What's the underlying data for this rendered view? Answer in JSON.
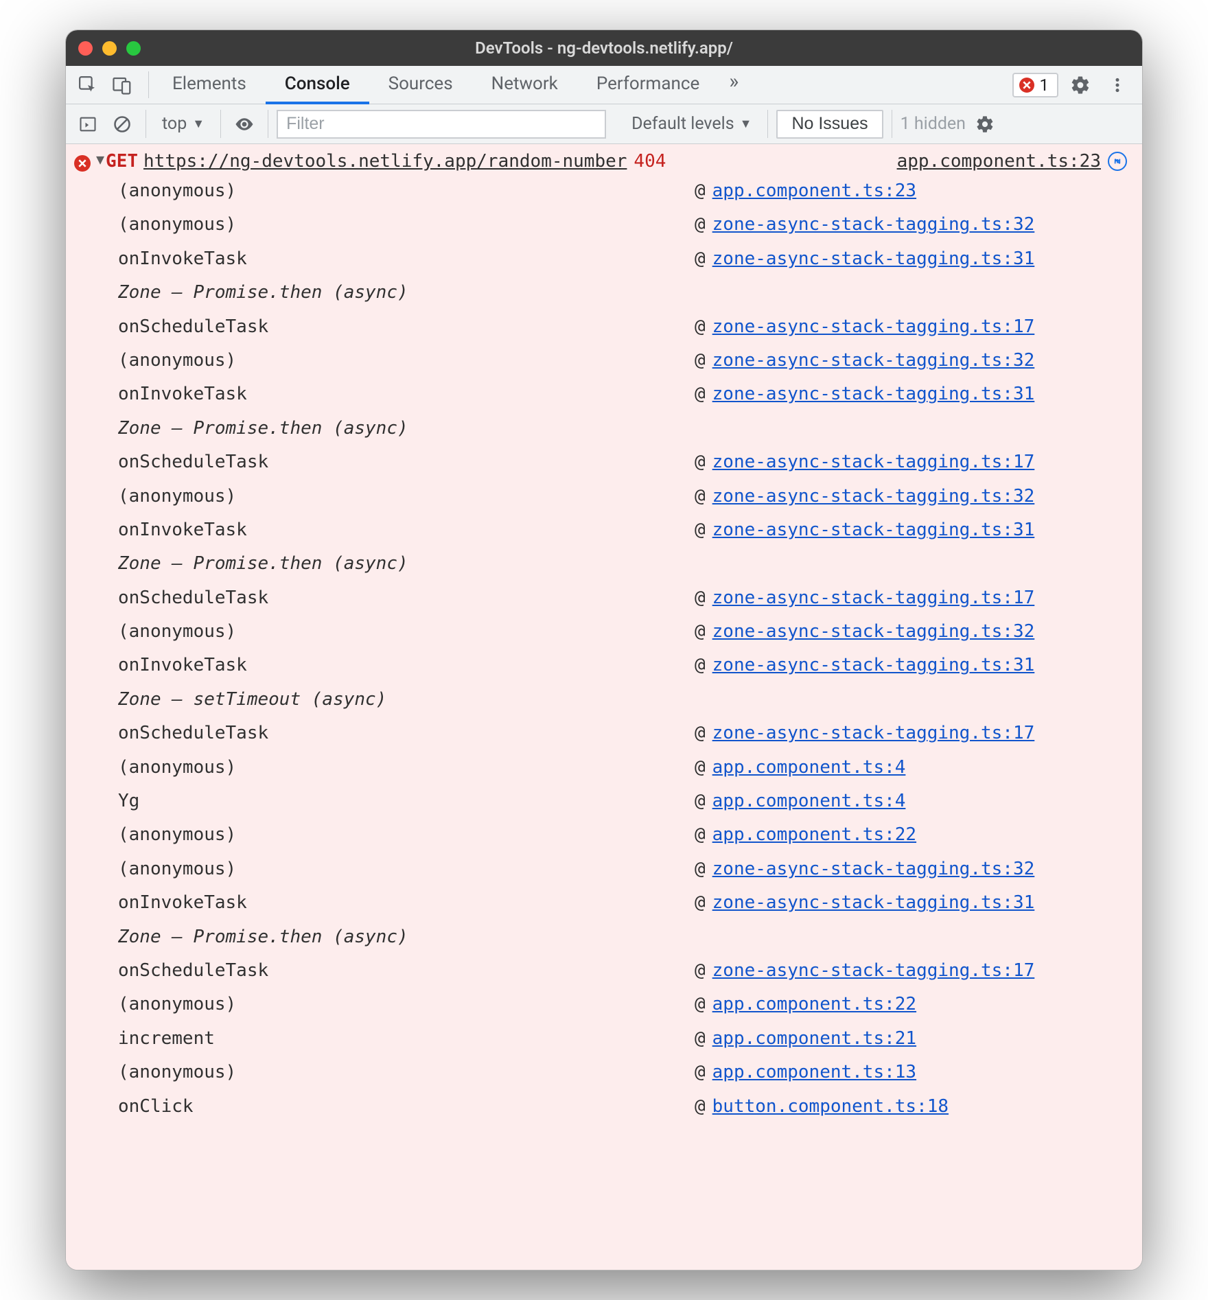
{
  "window": {
    "title": "DevTools - ng-devtools.netlify.app/"
  },
  "tabs": {
    "items": [
      "Elements",
      "Console",
      "Sources",
      "Network",
      "Performance"
    ],
    "active_index": 1,
    "overflow_glyph": "»",
    "error_count": "1"
  },
  "toolbar": {
    "context": "top",
    "filter_placeholder": "Filter",
    "levels_label": "Default levels",
    "issues_button": "No Issues",
    "hidden_label": "1 hidden"
  },
  "error": {
    "method": "GET",
    "url": "https://ng-devtools.netlify.app/random-number",
    "status": "404",
    "origin": "app.component.ts:23",
    "stack": [
      {
        "type": "frame",
        "fn": "(anonymous)",
        "src": "app.component.ts:23"
      },
      {
        "type": "frame",
        "fn": "(anonymous)",
        "src": "zone-async-stack-tagging.ts:32"
      },
      {
        "type": "frame",
        "fn": "onInvokeTask",
        "src": "zone-async-stack-tagging.ts:31"
      },
      {
        "type": "async",
        "label": "Zone — Promise.then (async)"
      },
      {
        "type": "frame",
        "fn": "onScheduleTask",
        "src": "zone-async-stack-tagging.ts:17"
      },
      {
        "type": "frame",
        "fn": "(anonymous)",
        "src": "zone-async-stack-tagging.ts:32"
      },
      {
        "type": "frame",
        "fn": "onInvokeTask",
        "src": "zone-async-stack-tagging.ts:31"
      },
      {
        "type": "async",
        "label": "Zone — Promise.then (async)"
      },
      {
        "type": "frame",
        "fn": "onScheduleTask",
        "src": "zone-async-stack-tagging.ts:17"
      },
      {
        "type": "frame",
        "fn": "(anonymous)",
        "src": "zone-async-stack-tagging.ts:32"
      },
      {
        "type": "frame",
        "fn": "onInvokeTask",
        "src": "zone-async-stack-tagging.ts:31"
      },
      {
        "type": "async",
        "label": "Zone — Promise.then (async)"
      },
      {
        "type": "frame",
        "fn": "onScheduleTask",
        "src": "zone-async-stack-tagging.ts:17"
      },
      {
        "type": "frame",
        "fn": "(anonymous)",
        "src": "zone-async-stack-tagging.ts:32"
      },
      {
        "type": "frame",
        "fn": "onInvokeTask",
        "src": "zone-async-stack-tagging.ts:31"
      },
      {
        "type": "async",
        "label": "Zone — setTimeout (async)"
      },
      {
        "type": "frame",
        "fn": "onScheduleTask",
        "src": "zone-async-stack-tagging.ts:17"
      },
      {
        "type": "frame",
        "fn": "(anonymous)",
        "src": "app.component.ts:4"
      },
      {
        "type": "frame",
        "fn": "Yg",
        "src": "app.component.ts:4"
      },
      {
        "type": "frame",
        "fn": "(anonymous)",
        "src": "app.component.ts:22"
      },
      {
        "type": "frame",
        "fn": "(anonymous)",
        "src": "zone-async-stack-tagging.ts:32"
      },
      {
        "type": "frame",
        "fn": "onInvokeTask",
        "src": "zone-async-stack-tagging.ts:31"
      },
      {
        "type": "async",
        "label": "Zone — Promise.then (async)"
      },
      {
        "type": "frame",
        "fn": "onScheduleTask",
        "src": "zone-async-stack-tagging.ts:17"
      },
      {
        "type": "frame",
        "fn": "(anonymous)",
        "src": "app.component.ts:22"
      },
      {
        "type": "frame",
        "fn": "increment",
        "src": "app.component.ts:21"
      },
      {
        "type": "frame",
        "fn": "(anonymous)",
        "src": "app.component.ts:13"
      },
      {
        "type": "frame",
        "fn": "onClick",
        "src": "button.component.ts:18"
      }
    ]
  }
}
